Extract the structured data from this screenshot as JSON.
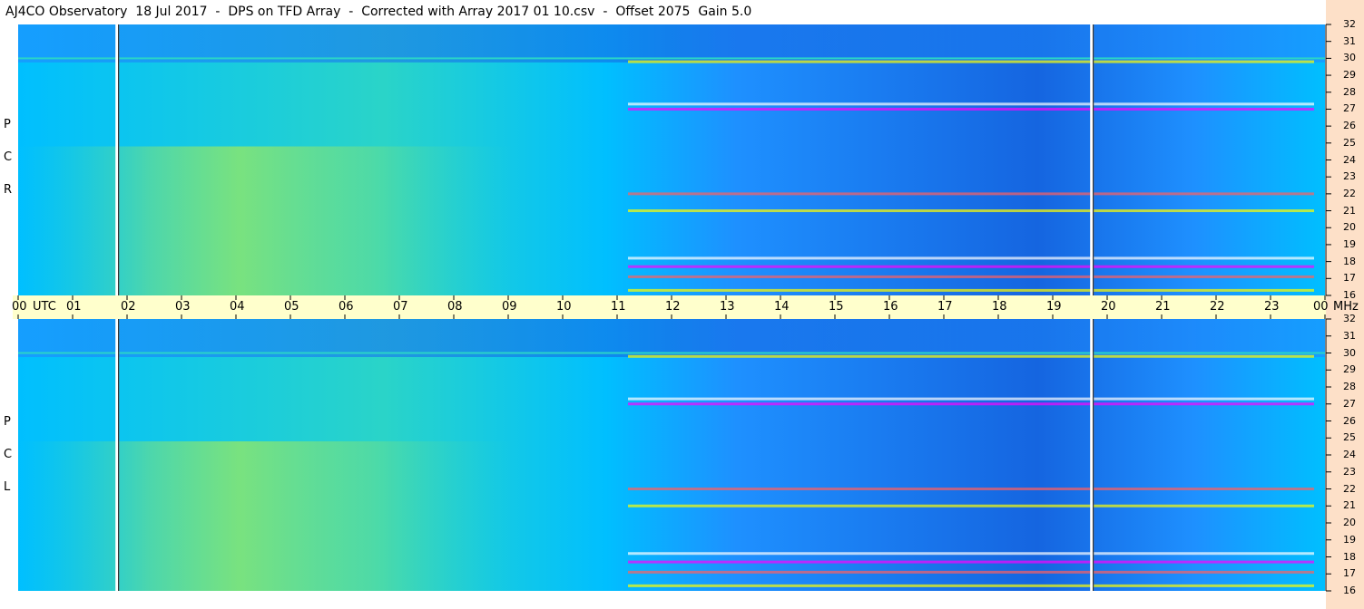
{
  "title": "AJ4CO Observatory  18 Jul 2017  -  DPS on TFD Array  -  Corrected with Array 2017 01 10.csv  -  Offset 2075  Gain 5.0",
  "chart_data": {
    "type": "heatmap",
    "panels": [
      {
        "name": "R C P",
        "letters": [
          "R",
          "C",
          "P"
        ]
      },
      {
        "name": "L C P",
        "letters": [
          "L",
          "C",
          "P"
        ]
      }
    ],
    "x_axis": {
      "label": "UTC",
      "range": [
        0,
        24
      ],
      "ticks": [
        "00",
        "01",
        "02",
        "03",
        "04",
        "05",
        "06",
        "07",
        "08",
        "09",
        "10",
        "11",
        "12",
        "13",
        "14",
        "15",
        "16",
        "17",
        "18",
        "19",
        "20",
        "21",
        "22",
        "23",
        "00"
      ]
    },
    "y_axis": {
      "unit": "MHz",
      "range": [
        16,
        32
      ],
      "ticks": [
        "16",
        "17",
        "18",
        "19",
        "20",
        "21",
        "22",
        "23",
        "24",
        "25",
        "26",
        "27",
        "28",
        "29",
        "30",
        "31",
        "32"
      ]
    },
    "colormap": [
      "#1565e0",
      "#1e90ff",
      "#00bfff",
      "#2ad4c8",
      "#7ee37a",
      "#ffff00",
      "#ff6060",
      "#ff00ff",
      "#ffffff"
    ],
    "vertical_gaps_utc": [
      1.82,
      19.72
    ],
    "interference_lines_mhz": [
      30.0
    ],
    "band_features_mhz": [
      16.3,
      17.1,
      17.7,
      18.2,
      21.0,
      22.0,
      27.0,
      27.3,
      29.8
    ]
  }
}
